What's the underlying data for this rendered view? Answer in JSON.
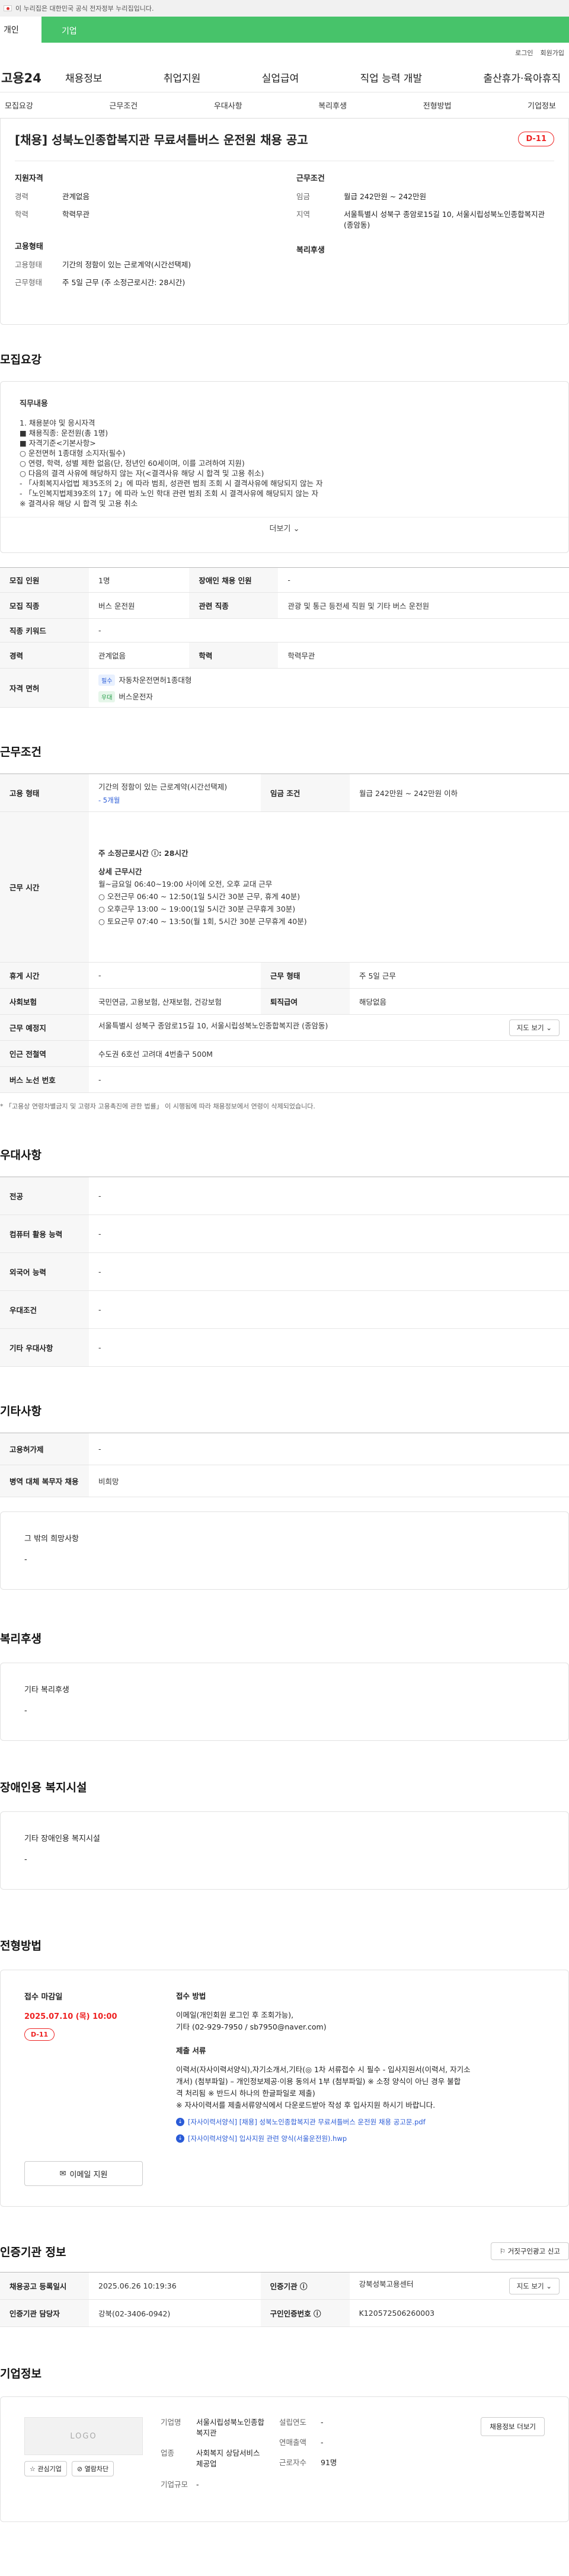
{
  "topbar": {
    "text": "이 누리집은 대한민국 공식 전자정부 누리집입니다."
  },
  "tabs": {
    "personal": "개인",
    "company": "기업"
  },
  "util": {
    "login": "로그인",
    "signup": "회원가입"
  },
  "gnb": {
    "logo": "고용24",
    "menu": [
      "채용정보",
      "취업지원",
      "실업급여",
      "직업 능력 개발",
      "출산휴가·육아휴직"
    ]
  },
  "anchor": [
    "모집요강",
    "근무조건",
    "우대사항",
    "복리후생",
    "전형방법",
    "기업정보"
  ],
  "job": {
    "title": "[채용] 성북노인종합복지관 무료셔틀버스 운전원 채용 공고",
    "dday": "D-11",
    "qual_title": "지원자격",
    "career_k": "경력",
    "career_v": "관계없음",
    "edu_k": "학력",
    "edu_v": "학력무관",
    "emp_title": "고용형태",
    "emptype_k": "고용형태",
    "emptype_v": "기간의 정함이 있는 근로계약(시간선택제)",
    "worktype_k": "근무형태",
    "worktype_v": "주 5일 근무 (주 소정근로시간: 28시간)",
    "cond_title": "근무조건",
    "wage_k": "임금",
    "wage_v": "월급 242만원 ~ 242만원",
    "region_k": "지역",
    "region_v": "서울특별시 성북구 종암로15길 10, 서울시립성북노인종합복지관 (종암동)",
    "welfare_title": "복리후생"
  },
  "recruit": {
    "title": "모집요강",
    "duty_h": "직무내용",
    "duty_lines": [
      "1. 채용분야 및 응시자격",
      "■ 채용직종: 운전원(총 1명)",
      "■ 자격기준<기본사항>",
      "○ 운전면허 1종대형 소지자(필수)",
      "○ 연령, 학력, 성별 제한 없음(단, 정년인 60세이며, 이를 고려하여 지원)",
      "○ 다음의 결격 사유에 해당하지 않는 자(<결격사유 해당 시 합격 및 고용 취소)",
      "- 「사회복지사업법 제35조의 2」에 따라 범죄, 성관련 범죄 조회 시 결격사유에 해당되지 않는 자",
      "- 「노인복지법제39조의 17」에 따라 노인 학대 관련 범죄 조회 시 결격사유에 해당되지 않는 자",
      "※ 결격사유 해당 시 합격 및 고용 취소"
    ],
    "more": "더보기",
    "rows": [
      [
        "모집 인원",
        "1명",
        "장애인 채용 인원",
        "-"
      ],
      [
        "모집 직종",
        "버스 운전원",
        "관련 직종",
        "관광 및 통근 등전세 직원 및 기타 버스 운전원"
      ],
      [
        "직종 키워드",
        "-"
      ],
      [
        "경력",
        "관계없음",
        "학력",
        "학력무관"
      ]
    ],
    "license_k": "자격 면허",
    "lic_req_tag": "필수",
    "lic_req": "자동차운전면허1종대형",
    "lic_pref_tag": "우대",
    "lic_pref": "버스운전자"
  },
  "work": {
    "title": "근무조건",
    "emptype_k": "고용 형태",
    "emptype_v": "기간의 정함이 있는 근로계약(시간선택제)",
    "emptype_sub": "- 5개월",
    "wage_k": "임금 조건",
    "wage_v": "월급 242만원 ~ 242만원 이하",
    "hours_k": "근무 시간",
    "hours_lines": [
      "주 소정근로시간 ⓘ: 28시간",
      "",
      "상세 근무시간",
      "월~금요일 06:40~19:00 사이에 오전, 오후 교대 근무",
      "○ 오전근무 06:40 ~ 12:50(1일 5시간 30분 근무, 휴게 40분)",
      "○ 오후근무 13:00 ~ 19:00(1일 5시간 30분 근무휴게 30분)",
      "○ 토요근무 07:40 ~ 13:50(월 1회, 5시간 30분 근무휴게 40분)"
    ],
    "rest_k": "휴게 시간",
    "rest_v": "-",
    "form_k": "근무 형태",
    "form_v": "주 5일 근무",
    "ins_k": "사회보험",
    "ins_v": "국민연금, 고용보험, 산재보험, 건강보험",
    "ret_k": "퇴직급여",
    "ret_v": "해당없음",
    "place_k": "근무 예정지",
    "place_v": "서울특별시 성북구 종암로15길 10, 서울시립성북노인종합복지관 (종암동)",
    "map": "지도 보기",
    "station_k": "인근 전철역",
    "station_v": "수도권 6호선 고려대 4번출구 500M",
    "bus_k": "버스 노선 번호",
    "bus_v": "-",
    "note": "* 「고용상 연령차별금지 및 고령자 고용촉진에 관한 법률」 이 시행됨에 따라 채용정보에서 연령이 삭제되었습니다."
  },
  "pref": {
    "title": "우대사항",
    "rows": [
      [
        "전공",
        "-"
      ],
      [
        "컴퓨터 활용 능력",
        "-"
      ],
      [
        "외국어 능력",
        "-"
      ],
      [
        "우대조건",
        "-"
      ],
      [
        "기타 우대사항",
        "-"
      ]
    ]
  },
  "etc": {
    "title": "기타사항",
    "rows": [
      [
        "고용허가제",
        "-"
      ],
      [
        "병역 대체 복무자 채용",
        "비희망"
      ]
    ],
    "hope_h": "그 밖의 희망사항",
    "hope_v": "-"
  },
  "welfare": {
    "title": "복리후생",
    "h": "기타 복리후생",
    "v": "-"
  },
  "disabled": {
    "title": "장애인용 복지시설",
    "h": "기타 장애인용 복지시설",
    "v": "-"
  },
  "selection": {
    "title": "전형방법",
    "deadline_h": "접수 마감일",
    "deadline_v": "2025.07.10 (목) 10:00",
    "dday": "D-11",
    "apply": "이메일 지원",
    "method_h": "접수 방법",
    "method_v": "이메일(개인회원 로그인 후 조회가능),",
    "method_v2": "기타 (02-929-7950 / sb7950@naver.com)",
    "docs_h": "제출 서류",
    "docs_lines": [
      "이력서(자사이력서양식),자기소개서,기타(◎ 1차 서류접수 시 필수 - 입사지원서(이력서, 자기소",
      "개서) (첨부파일) – 개인정보제공·이용 동의서 1부 (첨부파일) ※ 소정 양식이 아닌 경우 불합",
      "격 처리됨  ※ 반드시 하나의 한글파일로 제출)",
      "※ 자사이력서를 제출서류양식에서 다운로드받아 작성 후 입사지원 하시기 바랍니다."
    ],
    "file1": "[자사이력서양식] [채용] 성북노인종합복지관 무료셔틀버스 운전원 채용 공고문.pdf",
    "file2": "[자사이력서양식] 입사지원 관련 양식(서울운전원).hwp"
  },
  "agency": {
    "title": "인증기관 정보",
    "report": "거짓구인광고 신고",
    "reg_k": "채용공고 등록일시",
    "reg_v": "2025.06.26 10:19:36",
    "agency_k": "인증기관 ⓘ",
    "agency_v": "강북성북고용센터",
    "map": "지도 보기",
    "staff_k": "인증기관 담당자",
    "staff_v": "강북(02-3406-0942)",
    "num_k": "구인인증번호 ⓘ",
    "num_v": "K120572506260003"
  },
  "company": {
    "title": "기업정보",
    "logo": "LOGO",
    "fav": "관심기업",
    "block": "열람차단",
    "name_k": "기업명",
    "name_v": "서울시립성북노인종합복지관",
    "ind_k": "업종",
    "ind_v": "사회복지 상담서비스 제공업",
    "size_k": "기업규모",
    "size_v": "-",
    "year_k": "설립연도",
    "year_v": "-",
    "sales_k": "연매출액",
    "sales_v": "-",
    "emp_k": "근로자수",
    "emp_v": "91명",
    "more": "채용정보 더보기"
  }
}
